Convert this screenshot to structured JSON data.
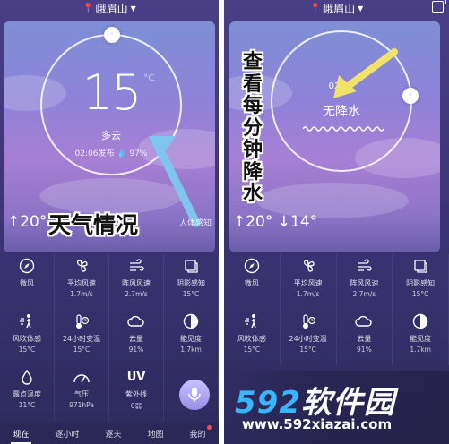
{
  "status": {
    "city": "峨眉山"
  },
  "left": {
    "temp": "15",
    "unit": "°C",
    "condition": "多云",
    "published": "02:06发布",
    "humidity": "97%",
    "high": "↑20°",
    "low": "↓1",
    "feel": "人体感知",
    "annotation": "天气情况"
  },
  "right": {
    "time": "02:37",
    "rain": "无降水",
    "high": "↑20°",
    "low": "↓14°",
    "annotation": "查看每分钟降水"
  },
  "details": [
    {
      "label": "微风",
      "value": "",
      "icon": "compass-icon"
    },
    {
      "label": "平均风速",
      "value": "1.7m/s",
      "icon": "wind-fan-icon"
    },
    {
      "label": "阵风风速",
      "value": "2.7m/s",
      "icon": "gust-icon"
    },
    {
      "label": "阴影感知",
      "value": "15°C",
      "icon": "shade-icon"
    },
    {
      "label": "风吹体感",
      "value": "15°C",
      "icon": "person-wind-icon"
    },
    {
      "label": "24小时变温",
      "value": "15°C",
      "icon": "thermometer-clock-icon"
    },
    {
      "label": "云量",
      "value": "91%",
      "icon": "cloud-icon"
    },
    {
      "label": "能见度",
      "value": "1.7km",
      "icon": "visibility-icon"
    },
    {
      "label": "露点温度",
      "value": "11°C",
      "icon": "drop-icon"
    },
    {
      "label": "气压",
      "value": "971hPa",
      "icon": "gauge-icon"
    },
    {
      "label": "紫外线",
      "value": "0弱",
      "icon": "uv-icon"
    },
    {
      "label": "",
      "value": "",
      "icon": ""
    }
  ],
  "details_right": [
    {
      "label": "微风",
      "value": ""
    },
    {
      "label": "平均风速",
      "value": "1.7m/s"
    },
    {
      "label": "阵风风速",
      "value": "2.7m/s"
    },
    {
      "label": "阴影感知",
      "value": "15°C"
    },
    {
      "label": "风吹体感",
      "value": "15°C"
    },
    {
      "label": "24小时变温",
      "value": "15°C"
    },
    {
      "label": "云量",
      "value": "91%"
    },
    {
      "label": "能见度",
      "value": "1.7km"
    }
  ],
  "tabs": [
    "现在",
    "逐小时",
    "逐天",
    "地图",
    "我的"
  ],
  "uv_text": "UV",
  "watermark": {
    "num": "592",
    "cn": "软件园",
    "url": "www.592xiazai.com"
  }
}
